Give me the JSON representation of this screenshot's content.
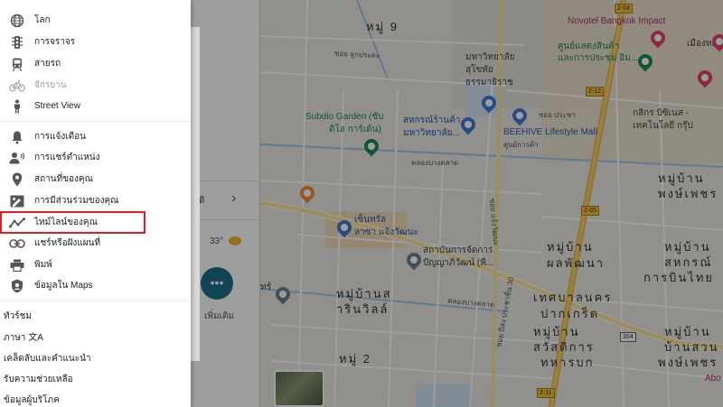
{
  "menu": {
    "layers": [
      {
        "icon": "globe-icon",
        "label": "โลก"
      },
      {
        "icon": "traffic-light-icon",
        "label": "การจราจร"
      },
      {
        "icon": "train-icon",
        "label": "สายรถ"
      },
      {
        "icon": "bicycle-icon",
        "label": "จักรยาน"
      },
      {
        "icon": "pegman-icon",
        "label": "Street View"
      }
    ],
    "actions": [
      {
        "icon": "bell-icon",
        "label": "การแจ้งเตือน"
      },
      {
        "icon": "location-sharing-icon",
        "label": "การแชร์ตำแหน่ง"
      },
      {
        "icon": "place-pin-icon",
        "label": "สถานที่ของคุณ"
      },
      {
        "icon": "contributions-icon",
        "label": "การมีส่วนร่วมของคุณ"
      },
      {
        "icon": "timeline-icon",
        "label": "ไทม์ไลน์ของคุณ"
      },
      {
        "icon": "link-icon",
        "label": "แชร์หรือฝังแผนที่"
      },
      {
        "icon": "printer-icon",
        "label": "พิมพ์"
      },
      {
        "icon": "shield-icon",
        "label": "ข้อมูลใน Maps"
      }
    ],
    "footer": [
      {
        "label": "ทัวร์ชม"
      },
      {
        "label": "ภาษา 文A"
      },
      {
        "label": "เคล็ดลับและคำแนะนำ"
      },
      {
        "label": "รับความช่วยเหลือ"
      },
      {
        "label": "ข้อมูลผู้บริโภค"
      }
    ]
  },
  "panel": {
    "row_text": "ดิ",
    "chevron": "›",
    "temperature": "33°",
    "more_button": "•••",
    "more_label": "เพิ่มเติม"
  },
  "map": {
    "labels": {
      "moo9": "หมู่ 9",
      "novotel": "Novotel Bangkok Impact",
      "impact_1": "ศูนย์แสดงสินค้า",
      "impact_2": "และการประชุม อิม...",
      "mueang_thong": "เมืองทองธ",
      "college_1": "มหาวิทยาลัย",
      "college_2": "สุโขทัย",
      "college_3": "ธรรมาธิราช",
      "subdio_1": "Subdio Garden (ซับ",
      "subdio_2": "ดิโอ การ์เด้น)",
      "coop_1": "สหกรณ์ร้านค้า",
      "coop_2": "มหาวิทยาลัย...",
      "beehive_1": "BEEHIVE Lifestyle Mall",
      "beehive_2": "ศูนย์การค้า",
      "kasikorn_1": "กสิกร บิซิเนส -",
      "kasikorn_2": "เทคโนโลยี กรุ๊ป",
      "moo_ban_east_1": "หมู่บ้าน",
      "moo_ban_east_2": "พงษ์เพชร",
      "central_1": "เซ็นทรัล",
      "central_2": "ลาซา แจ้งวัฒนะ",
      "institute_1": "สถาบันการจัดการ",
      "institute_2": "ปัญญาภิวัฒน์ (พี...",
      "phon_1": "หมู่บ้าน",
      "phon_2": "ผลพัฒนา",
      "sahakorn_1": "หมู่บ้าน",
      "sahakorn_2": "สหกรณ์",
      "sahakorn_3": "การบินไทย",
      "sarinvilla_1": "หมู่บ้านส",
      "sarinvilla_2": "ารินวิลล์",
      "pakkret_1": "เทศบาลนคร",
      "pakkret_2": "ปากเกร็ด",
      "suan_1": "หมู่บ้าน",
      "suan_2": "บ้านสวน",
      "suan_3": "พงษ์เพชร",
      "sawat_1": "หมู่บ้าน",
      "sawat_2": "สวัสดิการ",
      "sawat_3": "ทหารบก",
      "moo2": "หมู่ 2",
      "abo": "Abo",
      "wtai": "ทร์",
      "soi_school": "ซอย ลูกประคะ",
      "soi_prachachuen": "ซอย ปีสง ประชาชื่น 30",
      "soi_chaeng": "ซอย แจ้งวัฒนะ",
      "khlong": "คลองบางตลาด",
      "khlong2": "คลองบางตลาด",
      "soi_pinit": "ซอย ประชา",
      "road_204": "2-04",
      "road_212": "2-12",
      "road_205": "2-05",
      "road_211": "2-11",
      "road_304": "304"
    }
  }
}
